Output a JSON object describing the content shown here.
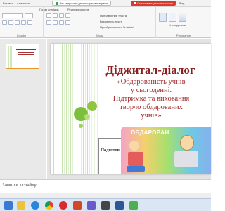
{
  "ribbon_tabs": [
    "Вставка",
    "Анимация",
    "Показ слайдов",
    "Рецензирование",
    "Вид"
  ],
  "presentation_notice": "Вы запустили демонстрацию экрана",
  "stop_button": "Остановить демонстрацию",
  "ribbon": {
    "group_font": "Шрифт",
    "group_paragraph": "Абзац",
    "group_drawing": "Рисование",
    "cmd_text_direction": "Направление текста",
    "cmd_align_text": "Выровнять текст",
    "cmd_convert_smartart": "Преобразовать в SmartArt",
    "cmd_arrange": "Упорядочить"
  },
  "slide": {
    "title": "Діджитал-діалог",
    "subtitle_lines": [
      "«Обдарованість учнів",
      "у сьогоденні.",
      "Підтримка та виховання",
      "творчо обдарованих",
      "учнів»"
    ],
    "signature_prefix": "Подготов",
    "art_caption": "ОБДАРОВАН"
  },
  "notes_placeholder": "Заметки к слайду",
  "taskbar_icons": [
    "start-icon",
    "file-explorer-icon",
    "edge-icon",
    "chrome-icon",
    "opera-icon",
    "powerpoint-icon",
    "music-icon",
    "media-icon",
    "word-icon",
    "app-icon"
  ],
  "colors": {
    "title": "#8a1f1f",
    "subtitle": "#a02a2a",
    "accent_green": "#88c24a",
    "stop_red": "#d83b2d"
  }
}
